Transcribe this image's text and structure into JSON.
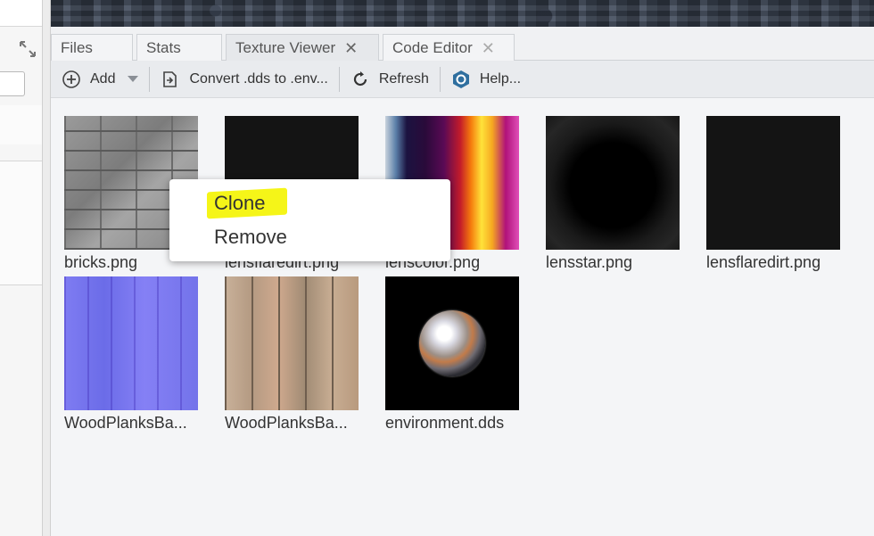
{
  "tabs": [
    {
      "label": "Files",
      "closable": false
    },
    {
      "label": "Stats",
      "closable": false
    },
    {
      "label": "Texture Viewer",
      "closable": true,
      "active": true
    },
    {
      "label": "Code Editor",
      "closable": true
    }
  ],
  "toolbar": {
    "add_label": "Add",
    "convert_label": "Convert .dds to .env...",
    "refresh_label": "Refresh",
    "help_label": "Help..."
  },
  "textures": [
    {
      "name": "bricks.png",
      "style": "bricks"
    },
    {
      "name": "lensflaredirt.png",
      "style": "dark"
    },
    {
      "name": "lenscolor.png",
      "style": "color"
    },
    {
      "name": "lensstar.png",
      "style": "star"
    },
    {
      "name": "lensflaredirt.png",
      "style": "dark"
    },
    {
      "name": "WoodPlanksBa...",
      "style": "normal"
    },
    {
      "name": "WoodPlanksBa...",
      "style": "wood"
    },
    {
      "name": "environment.dds",
      "style": "env"
    }
  ],
  "context_menu": {
    "items": [
      "Clone",
      "Remove"
    ],
    "highlight_color": "#f5f518"
  },
  "icons": {
    "expand": "expand-arrows-icon",
    "add": "plus-circle-icon",
    "convert": "convert-file-icon",
    "refresh": "refresh-icon",
    "help": "help-logo-icon"
  }
}
